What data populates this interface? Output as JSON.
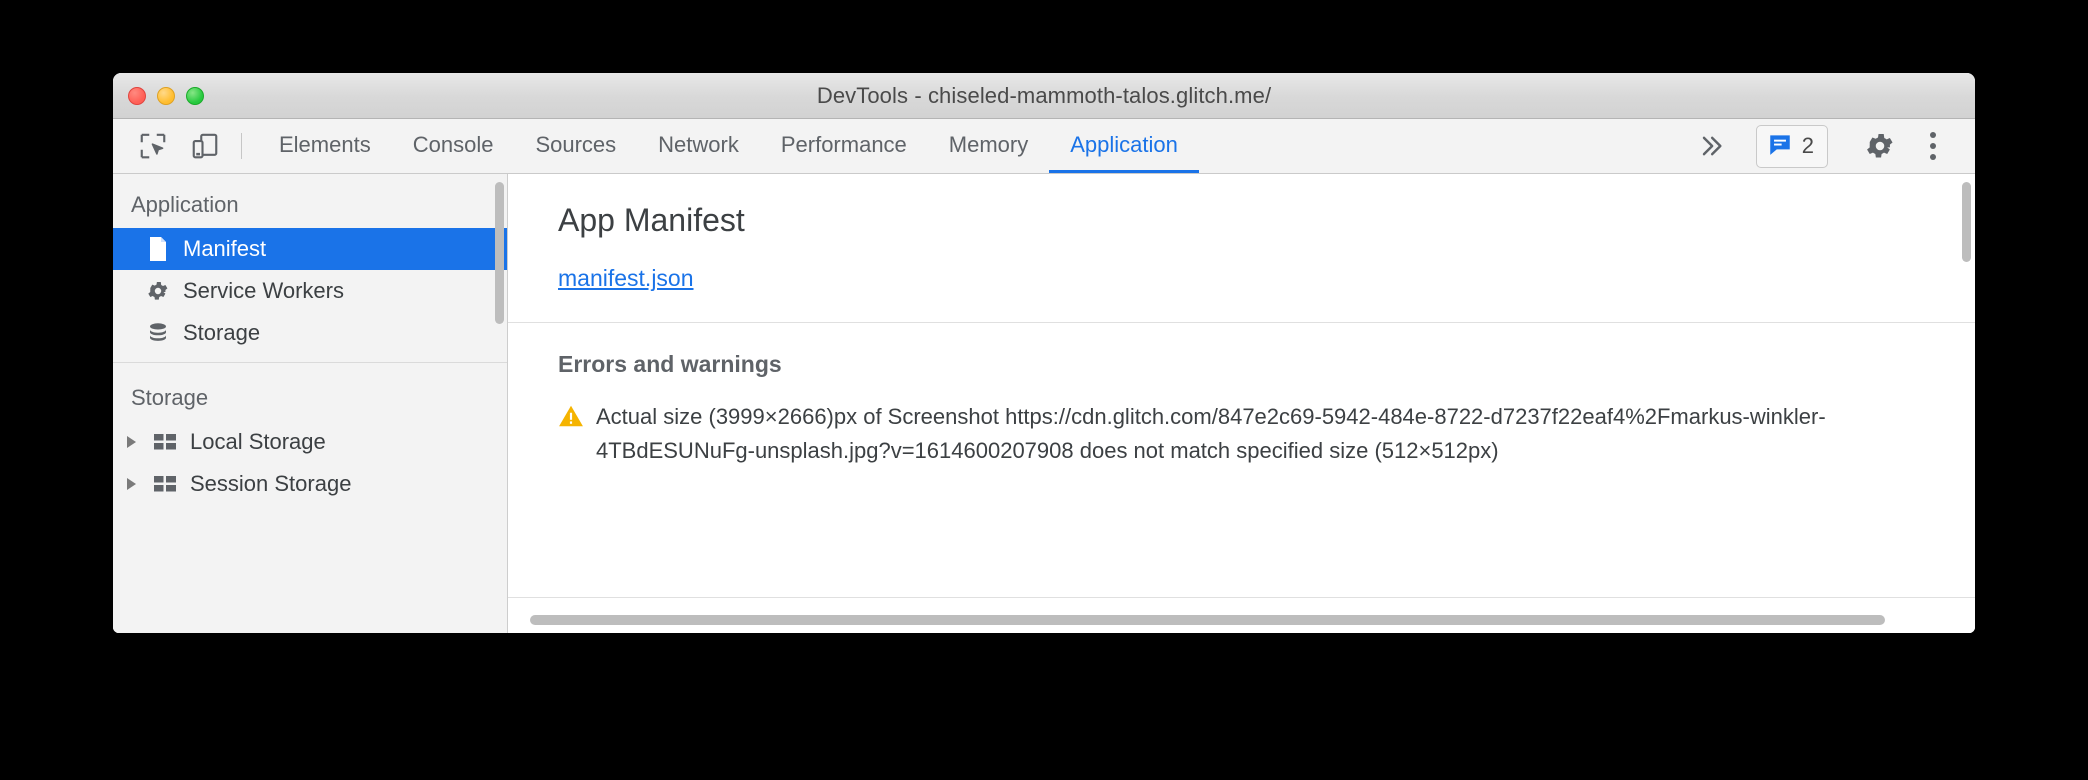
{
  "window": {
    "title": "DevTools - chiseled-mammoth-talos.glitch.me/",
    "traffic_lights": [
      {
        "name": "close",
        "color": "#ff5f56"
      },
      {
        "name": "minimize",
        "color": "#ffbd2e"
      },
      {
        "name": "zoom",
        "color": "#27c93f"
      }
    ]
  },
  "toolbar": {
    "inspect_icon": "inspect-cursor-icon",
    "device_icon": "device-toolbar-icon",
    "tabs": [
      {
        "label": "Elements",
        "active": false
      },
      {
        "label": "Console",
        "active": false
      },
      {
        "label": "Sources",
        "active": false
      },
      {
        "label": "Network",
        "active": false
      },
      {
        "label": "Performance",
        "active": false
      },
      {
        "label": "Memory",
        "active": false
      },
      {
        "label": "Application",
        "active": true
      }
    ],
    "overflow_label": "»",
    "messages": {
      "icon": "message-bubble-icon",
      "count": "2",
      "accent": "#1a73e8"
    },
    "settings_icon": "gear-icon",
    "more_icon": "more-vertical-icon",
    "active_accent": "#1a73e8"
  },
  "sidebar": {
    "groups": [
      {
        "title": "Application",
        "items": [
          {
            "label": "Manifest",
            "icon": "document-icon",
            "selected": true,
            "tree": false
          },
          {
            "label": "Service Workers",
            "icon": "gear-icon",
            "selected": false,
            "tree": false
          },
          {
            "label": "Storage",
            "icon": "database-icon",
            "selected": false,
            "tree": false
          }
        ]
      },
      {
        "title": "Storage",
        "items": [
          {
            "label": "Local Storage",
            "icon": "table-icon",
            "selected": false,
            "tree": true
          },
          {
            "label": "Session Storage",
            "icon": "table-icon",
            "selected": false,
            "tree": true
          }
        ]
      }
    ],
    "selected_bg": "#1a73e8"
  },
  "main": {
    "heading": "App Manifest",
    "manifest_link": "manifest.json",
    "errors_section": {
      "heading": "Errors and warnings",
      "items": [
        {
          "icon": "warning-triangle-icon",
          "icon_color": "#f5b400",
          "text": "Actual size (3999×2666)px of Screenshot https://cdn.glitch.com/847e2c69-5942-484e-8722-d7237f22eaf4%2Fmarkus-winkler-4TBdESUNuFg-unsplash.jpg?v=1614600207908 does not match specified size (512×512px)"
        }
      ]
    }
  }
}
